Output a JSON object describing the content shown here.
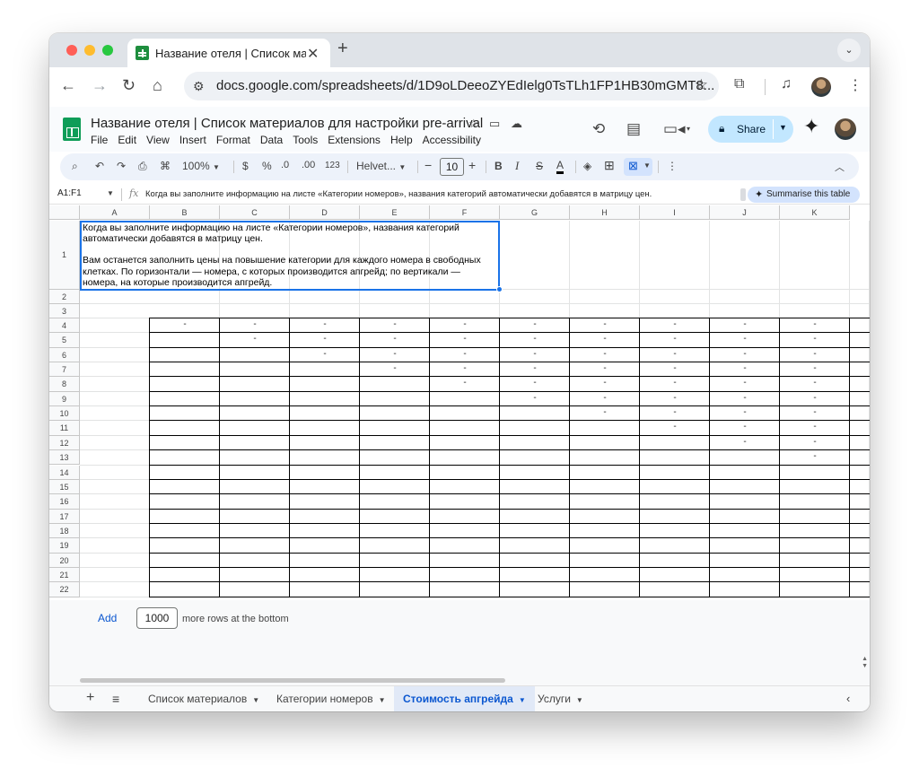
{
  "browser": {
    "tab_title": "Название отеля | Список ма",
    "url": "docs.google.com/spreadsheets/d/1D9oLDeeoZYEdIelg0TsTLh1FP1HB30mGMT8...",
    "icons": [
      "close-icon",
      "plus-icon",
      "chevron-down-icon",
      "back-icon",
      "forward-icon",
      "reload-icon",
      "home-icon",
      "tune-icon",
      "star-icon",
      "extensions-icon",
      "media-icon",
      "menu-dots-icon"
    ]
  },
  "doc": {
    "title": "Название отеля | Список материалов для настройки pre-arrival",
    "menu": [
      "File",
      "Edit",
      "View",
      "Insert",
      "Format",
      "Data",
      "Tools",
      "Extensions",
      "Help",
      "Accessibility"
    ],
    "share_label": "Share"
  },
  "toolbar": {
    "zoom": "100%",
    "currency": "$",
    "percent": "%",
    "dec_decrease": ".0",
    "dec_increase": ".00",
    "number_format": "123",
    "font": "Helvet...",
    "minus": "−",
    "font_size": "10",
    "plus": "+",
    "bold": "B",
    "italic": "I",
    "strike": "S",
    "text_color": "A"
  },
  "formula_bar": {
    "name_box": "A1:F1",
    "content": "Когда вы заполните информацию на листе «Категории номеров», названия категорий автоматически добавятся в матрицу цен.",
    "summarise": "Summarise this table"
  },
  "columns": [
    "A",
    "B",
    "C",
    "D",
    "E",
    "F",
    "G",
    "H",
    "I",
    "J",
    "K"
  ],
  "rows": [
    "1",
    "2",
    "3",
    "4",
    "5",
    "6",
    "7",
    "8",
    "9",
    "10",
    "11",
    "12",
    "13",
    "14",
    "15",
    "16",
    "17",
    "18",
    "19",
    "20",
    "21",
    "22"
  ],
  "cell_a1": {
    "line1": "Когда вы заполните информацию на листе «Категории номеров», названия категорий автоматически добавятся в матрицу цен.",
    "line2": "Вам останется заполнить цены на повышение категории для каждого номера в свободных клетках. По горизонтали — номера, с которых производится апгрейд; по вертикали — номера, на которые производится апгрейд."
  },
  "matrix_dash": "-",
  "add_rows": {
    "button": "Add",
    "count": "1000",
    "label": "more rows at the bottom"
  },
  "sheet_tabs": [
    {
      "label": "Список материалов",
      "active": false
    },
    {
      "label": "Категории номеров",
      "active": false
    },
    {
      "label": "Стоимость апгрейда",
      "active": true
    },
    {
      "label": "Услуги",
      "active": false
    }
  ],
  "colors": {
    "selection": "#1a73e8",
    "active_tab": "#0b57d0",
    "share_bg": "#c2e7ff"
  }
}
